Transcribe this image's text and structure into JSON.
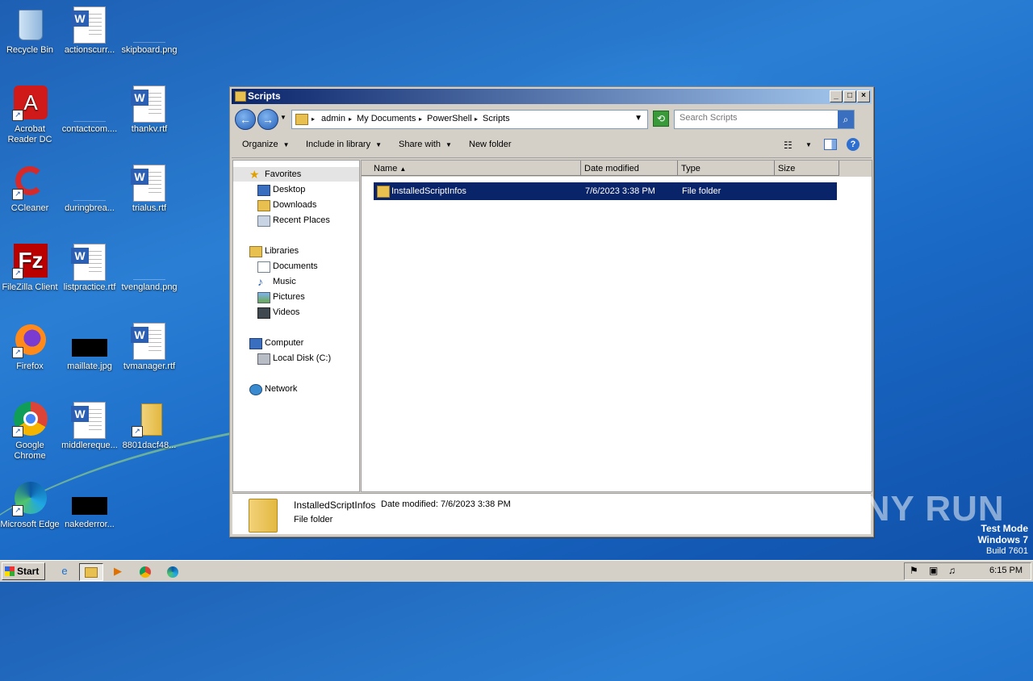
{
  "desktop": {
    "icons": [
      {
        "label": "Recycle Bin"
      },
      {
        "label": "actionscurr..."
      },
      {
        "label": "skipboard.png"
      },
      {
        "label": "Acrobat Reader DC"
      },
      {
        "label": "contactcom...."
      },
      {
        "label": "thankv.rtf"
      },
      {
        "label": "CCleaner"
      },
      {
        "label": "duringbrea..."
      },
      {
        "label": "trialus.rtf"
      },
      {
        "label": "FileZilla Client"
      },
      {
        "label": "listpractice.rtf"
      },
      {
        "label": "tvengland.png"
      },
      {
        "label": "Firefox"
      },
      {
        "label": "maillate.jpg"
      },
      {
        "label": "tvmanager.rtf"
      },
      {
        "label": "Google Chrome"
      },
      {
        "label": "middlereque..."
      },
      {
        "label": "8801dacf48..."
      },
      {
        "label": "Microsoft Edge"
      },
      {
        "label": "nakederror..."
      }
    ]
  },
  "window": {
    "title": "Scripts",
    "breadcrumbs": [
      "admin",
      "My Documents",
      "PowerShell",
      "Scripts"
    ],
    "search_placeholder": "Search Scripts",
    "toolbar": {
      "organize": "Organize",
      "include_in_library": "Include in library",
      "share_with": "Share with",
      "new_folder": "New folder"
    },
    "nav": {
      "favorites": "Favorites",
      "desktop": "Desktop",
      "downloads": "Downloads",
      "recent_places": "Recent Places",
      "libraries": "Libraries",
      "documents": "Documents",
      "music": "Music",
      "pictures": "Pictures",
      "videos": "Videos",
      "computer": "Computer",
      "local_disk": "Local Disk (C:)",
      "network": "Network"
    },
    "columns": {
      "name": "Name",
      "date_modified": "Date modified",
      "type": "Type",
      "size": "Size"
    },
    "files": [
      {
        "name": "InstalledScriptInfos",
        "date_modified": "7/6/2023 3:38 PM",
        "type": "File folder",
        "size": ""
      }
    ],
    "details": {
      "name": "InstalledScriptInfos",
      "date_label": "Date modified:",
      "date_value": "7/6/2023 3:38 PM",
      "type": "File folder"
    }
  },
  "watermark": "ANY RUN",
  "test_mode": {
    "line1": "Test Mode",
    "line2": "Windows 7",
    "line3": "Build 7601"
  },
  "taskbar": {
    "start": "Start",
    "clock": "6:15 PM"
  }
}
